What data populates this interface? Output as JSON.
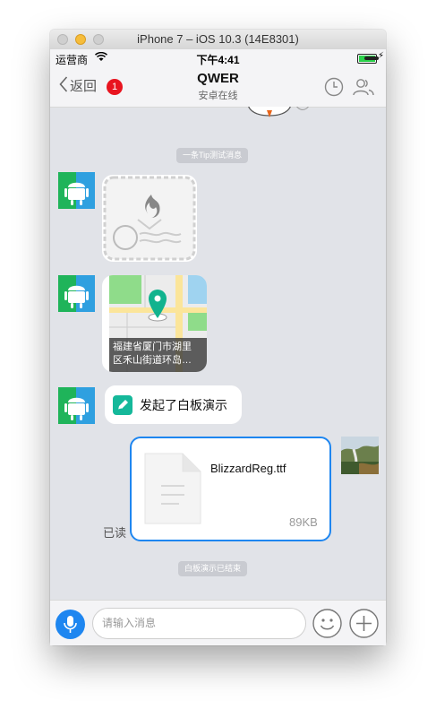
{
  "window": {
    "title": "iPhone 7 – iOS 10.3 (14E8301)"
  },
  "status_bar": {
    "carrier": "运营商",
    "time": "下午4:41"
  },
  "nav": {
    "back_label": "返回",
    "unread_badge": "1",
    "title": "QWER",
    "subtitle": "安卓在线"
  },
  "messages": {
    "tip1": "一条Tip测试消息",
    "location_address": "福建省厦门市湖里\n区禾山街道环岛…",
    "whiteboard_text": "发起了白板演示",
    "read_status": "已读",
    "file_name": "BlizzardReg.ttf",
    "file_size": "89KB",
    "tip2": "白板演示已结束"
  },
  "input_bar": {
    "placeholder": "请输入消息"
  },
  "icons": [
    "back-chevron-icon",
    "history-clock-icon",
    "contacts-icon",
    "android-avatar-icon",
    "envelope-burn-icon",
    "map-pin-icon",
    "pencil-icon",
    "document-icon",
    "microphone-icon",
    "emoji-icon",
    "plus-icon"
  ],
  "colors": {
    "accent": "#1e86f0",
    "badge": "#e8141f",
    "chat_bg": "#e1e3e8"
  }
}
